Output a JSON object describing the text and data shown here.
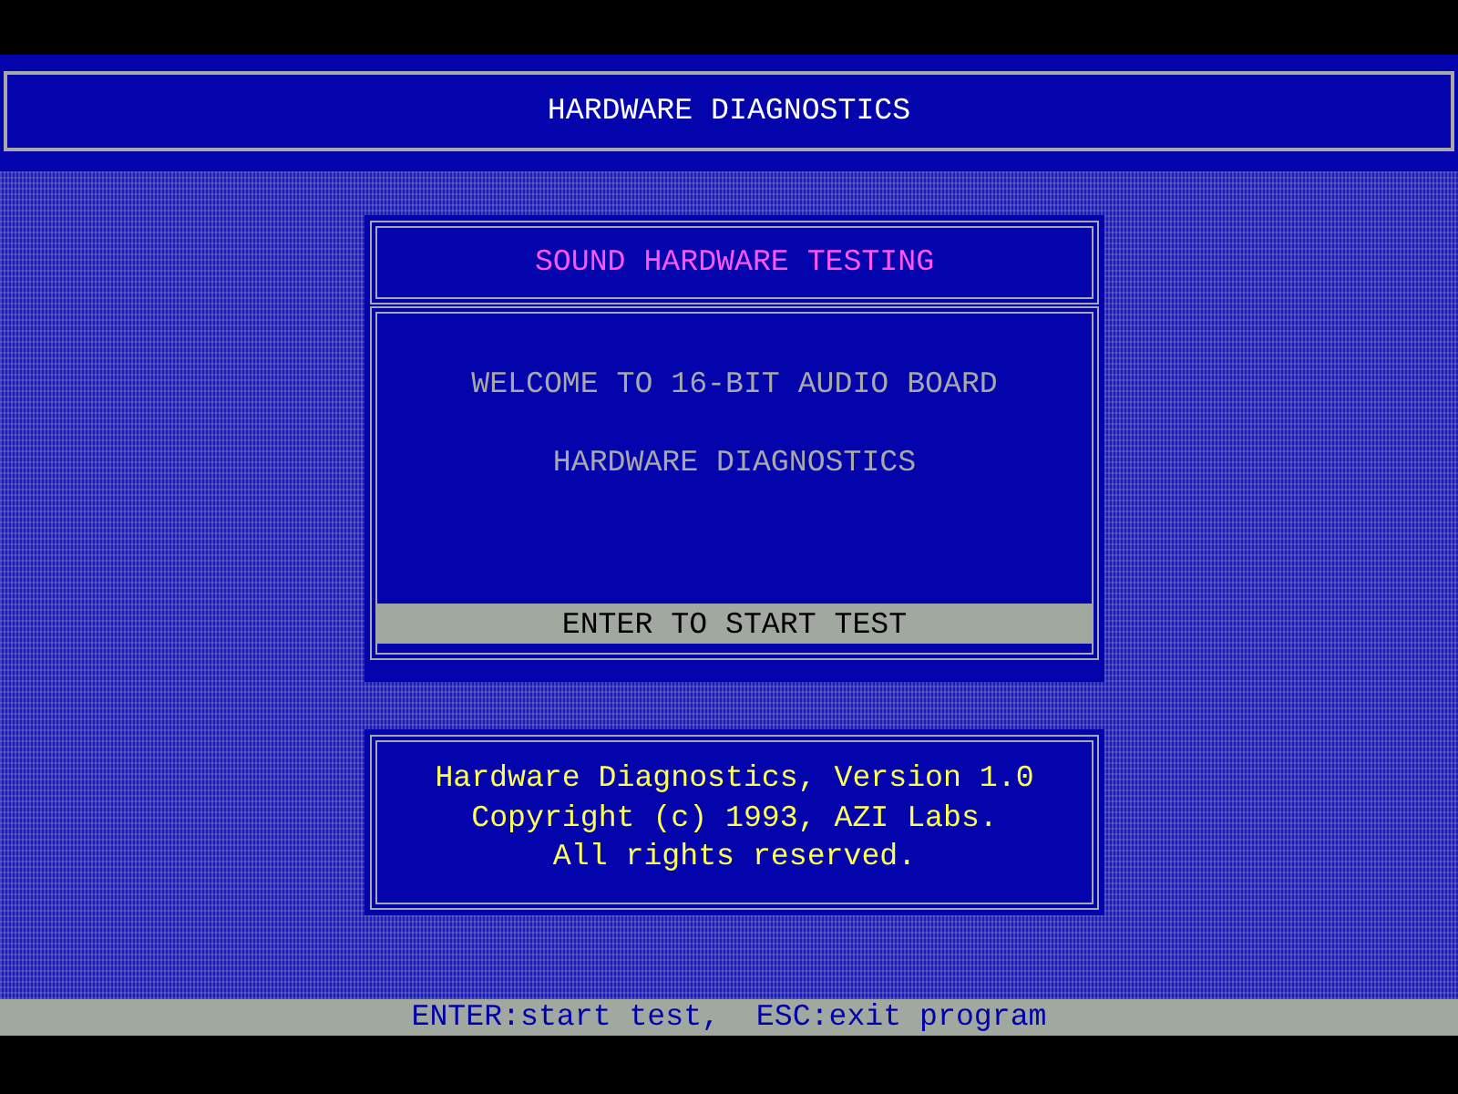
{
  "header": {
    "title": "HARDWARE DIAGNOSTICS"
  },
  "dialog": {
    "title": "SOUND HARDWARE TESTING",
    "lines": [
      "WELCOME TO 16-BIT AUDIO BOARD",
      "HARDWARE DIAGNOSTICS"
    ],
    "button": {
      "label": "ENTER TO START TEST",
      "selected": true
    }
  },
  "about": {
    "lines": [
      "Hardware Diagnostics, Version 1.0",
      "Copyright (c) 1993, AZI Labs.",
      "All rights reserved."
    ]
  },
  "status_bar": {
    "text": "ENTER:start test,  ESC:exit program"
  }
}
